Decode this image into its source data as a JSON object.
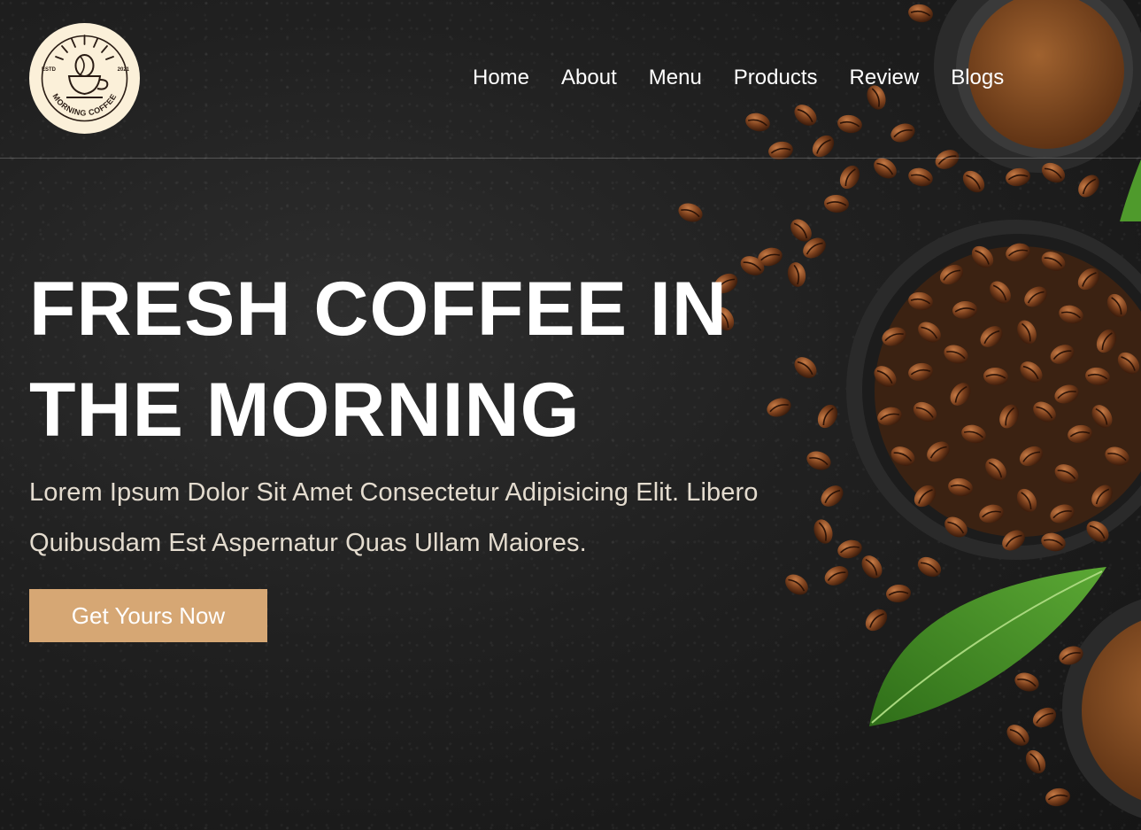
{
  "brand": {
    "logo_text": "MORNING COFFEE",
    "estd_label": "ESTD",
    "year": "2021"
  },
  "nav": {
    "items": [
      {
        "label": "Home"
      },
      {
        "label": "About"
      },
      {
        "label": "Menu"
      },
      {
        "label": "Products"
      },
      {
        "label": "Review"
      },
      {
        "label": "Blogs"
      }
    ]
  },
  "hero": {
    "title_line1": "FRESH COFFEE IN",
    "title_line2": "THE MORNING",
    "description_line1": "Lorem Ipsum Dolor Sit Amet Consectetur Adipisicing Elit. Libero",
    "description_line2": "Quibusdam Est Aspernatur Quas Ullam Maiores.",
    "cta_label": "Get Yours Now"
  },
  "colors": {
    "accent": "#d6a774",
    "background": "#1c1c1c",
    "logo_bg": "#fbf0d9",
    "bean": "#7a3f1c",
    "leaf": "#3f8a24"
  },
  "icons": {
    "logo": "coffee-cup-icon"
  }
}
